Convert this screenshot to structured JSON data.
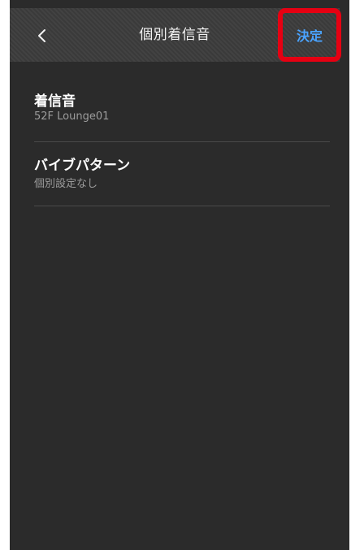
{
  "header": {
    "title": "個別着信音",
    "confirm_label": "決定",
    "back_icon": "chevron-left-icon"
  },
  "settings": [
    {
      "label": "着信音",
      "value": "52F Lounge01"
    },
    {
      "label": "バイブパターン",
      "value": "個別設定なし"
    }
  ],
  "colors": {
    "background": "#2b2b2b",
    "header_bg": "#3c3c3c",
    "accent": "#4aa3ff",
    "highlight": "#e60012",
    "divider": "#4a4a4a"
  }
}
